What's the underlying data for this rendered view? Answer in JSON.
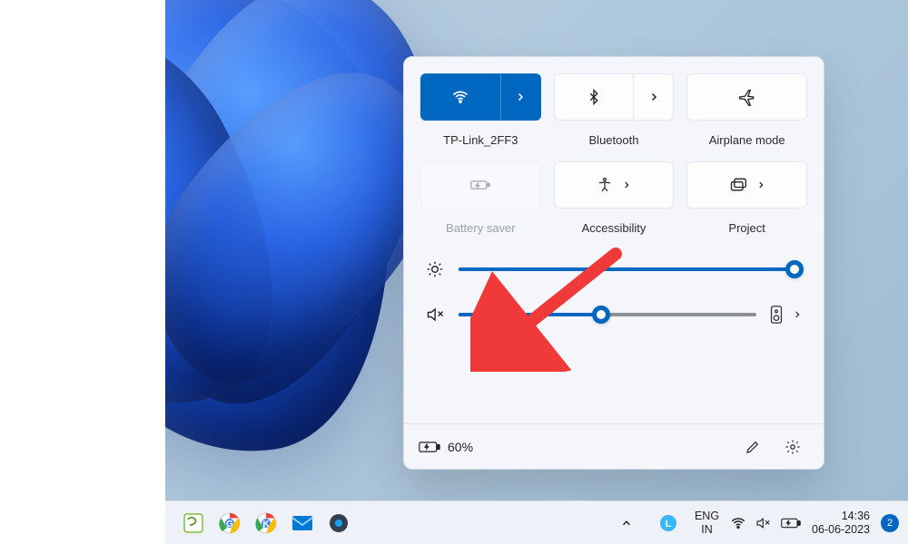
{
  "quick_settings": {
    "tiles": [
      {
        "id": "wifi",
        "label": "TP-Link_2FF3",
        "active": true,
        "split": true,
        "icon": "wifi-icon"
      },
      {
        "id": "bluetooth",
        "label": "Bluetooth",
        "active": false,
        "split": true,
        "icon": "bluetooth-icon"
      },
      {
        "id": "airplane",
        "label": "Airplane mode",
        "active": false,
        "split": false,
        "icon": "airplane-icon"
      },
      {
        "id": "battery-saver",
        "label": "Battery saver",
        "active": false,
        "disabled": true,
        "split": false,
        "icon": "battery-saver-icon"
      },
      {
        "id": "accessibility",
        "label": "Accessibility",
        "active": false,
        "split": false,
        "has_arrow": true,
        "icon": "accessibility-icon"
      },
      {
        "id": "project",
        "label": "Project",
        "active": false,
        "split": false,
        "has_arrow": true,
        "icon": "project-icon"
      }
    ],
    "brightness": {
      "value": 98,
      "icon": "brightness-icon"
    },
    "volume": {
      "value": 48,
      "muted": true,
      "icon": "volume-muted-icon",
      "output_icon": "speaker-device-icon"
    },
    "footer": {
      "battery_level": "60%",
      "battery_icon": "battery-charging-icon",
      "edit_icon": "pencil-icon",
      "settings_icon": "gear-icon"
    }
  },
  "annotation": {
    "arrow_color": "#f03a3a",
    "points_to": "volume-muted-icon"
  },
  "taskbar": {
    "apps": [
      {
        "id": "notepadpp",
        "color": "#7cbf3a"
      },
      {
        "id": "chrome-g",
        "color": "#ffffff"
      },
      {
        "id": "chrome-k",
        "color": "#ffffff"
      },
      {
        "id": "mail",
        "color": "#0078d4"
      },
      {
        "id": "settings",
        "color": "#5b6670"
      }
    ],
    "overflow_icon": "chevron-up-icon",
    "tray": {
      "lync_badge": "L",
      "language": {
        "top": "ENG",
        "bottom": "IN"
      },
      "status_icons": [
        "wifi-icon",
        "volume-muted-icon",
        "battery-charging-icon"
      ],
      "clock": {
        "time": "14:36",
        "date": "06-06-2023"
      },
      "notifications_count": "2"
    }
  }
}
